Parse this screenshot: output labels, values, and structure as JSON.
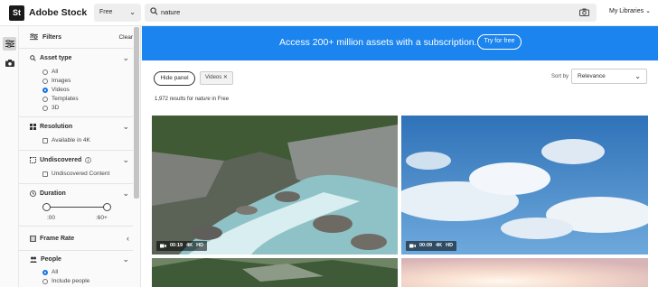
{
  "header": {
    "logo": "St",
    "brand": "Adobe Stock",
    "filter_value": "Free",
    "search_value": "nature",
    "libraries_label": "My Libraries"
  },
  "panel": {
    "title": "Filters",
    "clear_label": "Clear",
    "asset_type": {
      "title": "Asset type",
      "options": [
        "All",
        "Images",
        "Videos",
        "Templates",
        "3D"
      ],
      "selected": "Videos"
    },
    "resolution": {
      "title": "Resolution",
      "option": "Available in 4K"
    },
    "undiscovered": {
      "title": "Undiscovered",
      "option": "Undiscovered Content"
    },
    "duration": {
      "title": "Duration",
      "min_label": ":00",
      "max_label": ":60+"
    },
    "frame_rate": {
      "title": "Frame Rate"
    },
    "people": {
      "title": "People",
      "options": [
        "All",
        "Include people"
      ],
      "selected": "All"
    }
  },
  "banner": {
    "text": "Access 200+ million assets with a subscription.",
    "button": "Try for free"
  },
  "toolbar": {
    "hide_panel": "Hide panel",
    "chip_label": "Videos",
    "sort_label": "Sort by",
    "sort_value": "Relevance"
  },
  "results": {
    "count": "1,972",
    "middle": "results for",
    "term": "nature",
    "suffix": "in Free"
  },
  "videos": [
    {
      "duration": "00:19",
      "res": "4K",
      "quality": "HD"
    },
    {
      "duration": "00:09",
      "res": "4K",
      "quality": "HD"
    }
  ],
  "colors": {
    "accent": "#1b84ee",
    "selected": "#1473e6"
  }
}
